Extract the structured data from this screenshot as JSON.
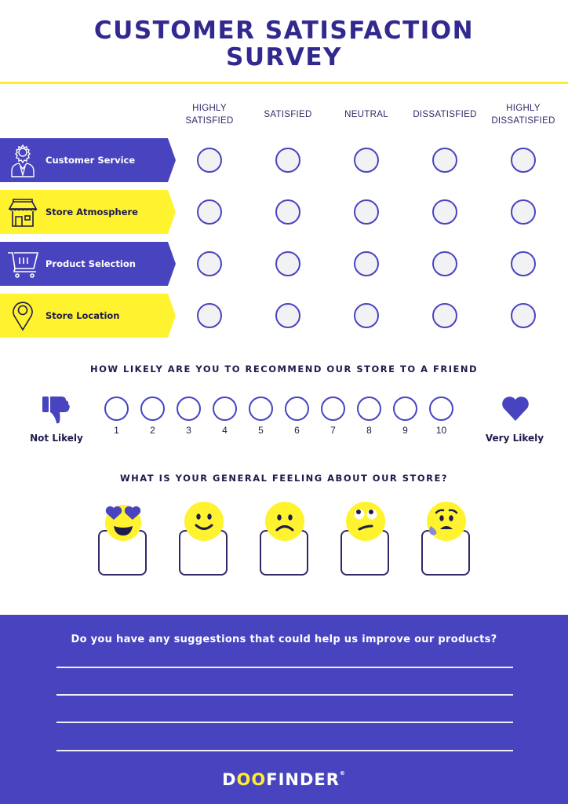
{
  "header": {
    "title_line1": "CUSTOMER SATISFACTION",
    "title_line2": "SURVEY"
  },
  "colors": {
    "brand_purple": "#4844c0",
    "brand_yellow": "#fff22e",
    "dark_text": "#1e1b4d"
  },
  "rating_scale": {
    "columns": [
      {
        "line1": "HIGHLY",
        "line2": "SATISFIED"
      },
      {
        "line1": "SATISFIED",
        "line2": ""
      },
      {
        "line1": "NEUTRAL",
        "line2": ""
      },
      {
        "line1": "DISSATISFIED",
        "line2": ""
      },
      {
        "line1": "HIGHLY",
        "line2": "DISSATISFIED"
      }
    ],
    "rows": [
      {
        "label": "Customer Service",
        "icon": "customer-service-icon",
        "style": "purple"
      },
      {
        "label": "Store Atmosphere",
        "icon": "storefront-icon",
        "style": "yellow"
      },
      {
        "label": "Product Selection",
        "icon": "shopping-cart-icon",
        "style": "purple"
      },
      {
        "label": "Store Location",
        "icon": "location-pin-icon",
        "style": "yellow"
      }
    ]
  },
  "recommend": {
    "question": "HOW LIKELY ARE YOU TO RECOMMEND OUR STORE TO A FRIEND",
    "low_label": "Not Likely",
    "high_label": "Very Likely",
    "low_icon": "thumbs-down-icon",
    "high_icon": "heart-icon",
    "options": [
      "1",
      "2",
      "3",
      "4",
      "5",
      "6",
      "7",
      "8",
      "9",
      "10"
    ]
  },
  "feeling": {
    "question": "WHAT IS YOUR GENERAL FEELING ABOUT OUR STORE?",
    "options": [
      {
        "icon": "heart-eyes-emoji-icon"
      },
      {
        "icon": "smile-emoji-icon"
      },
      {
        "icon": "frown-emoji-icon"
      },
      {
        "icon": "eye-roll-emoji-icon"
      },
      {
        "icon": "worried-sweat-emoji-icon"
      }
    ]
  },
  "suggestions": {
    "question": "Do you have any suggestions that could help us improve our products?",
    "line_count": 4
  },
  "footer": {
    "logo_prefix": "D",
    "logo_oo": "OO",
    "logo_suffix": "FINDER",
    "logo_mark": "®"
  }
}
